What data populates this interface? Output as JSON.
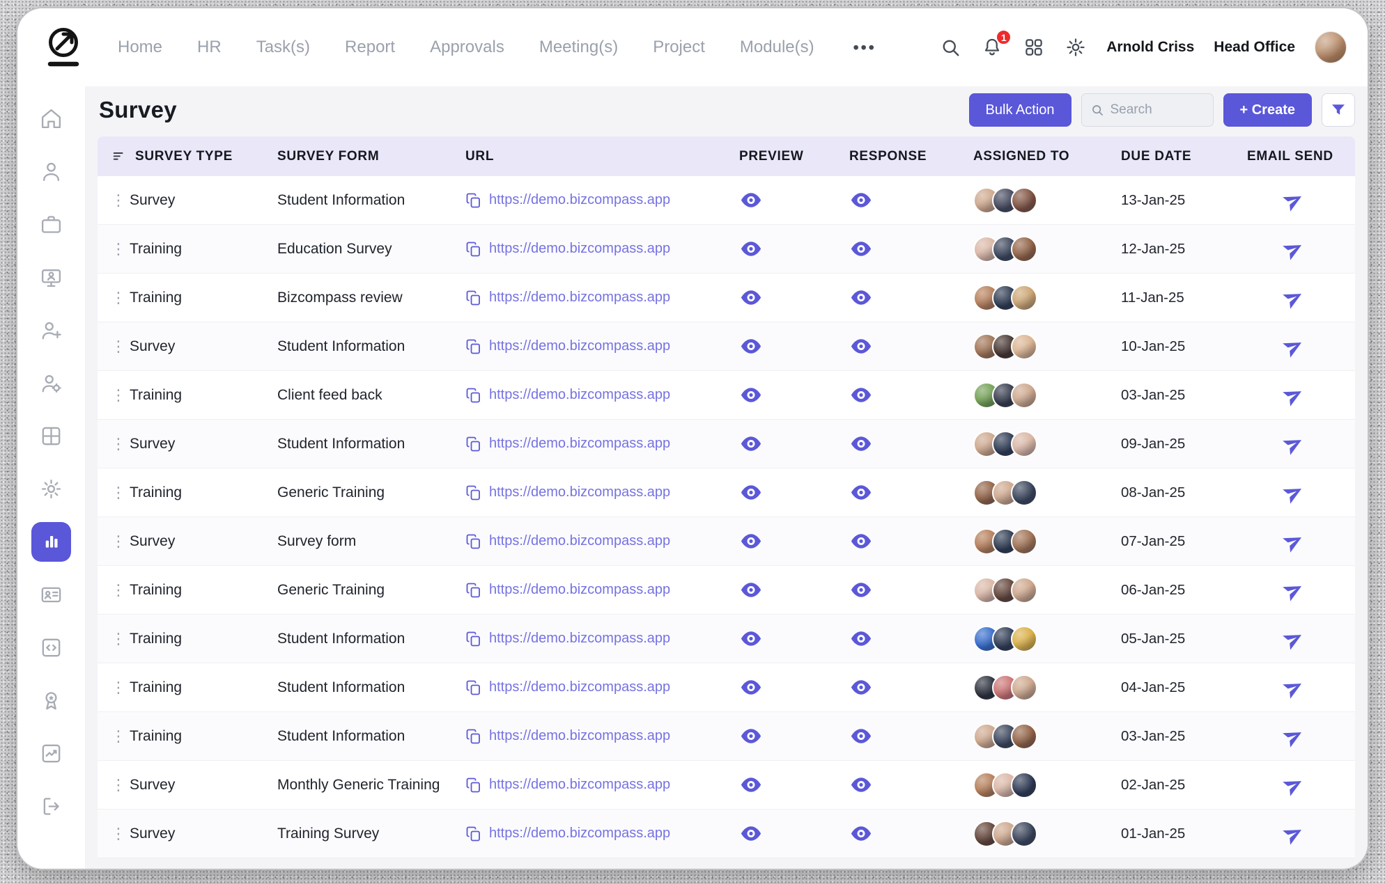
{
  "topnav": {
    "items": [
      "Home",
      "HR",
      "Task(s)",
      "Report",
      "Approvals",
      "Meeting(s)",
      "Project",
      "Module(s)"
    ],
    "notification_count": "1",
    "user_name": "Arnold Criss",
    "location": "Head Office"
  },
  "icons": {
    "more_menu": "•••",
    "drag_handle": "⋮"
  },
  "page": {
    "title": "Survey",
    "bulk_action_label": "Bulk Action",
    "search_placeholder": "Search",
    "create_label": "+ Create"
  },
  "table": {
    "headers": [
      "SURVEY TYPE",
      "SURVEY FORM",
      "URL",
      "PREVIEW",
      "RESPONSE",
      "ASSIGNED TO",
      "DUE DATE",
      "EMAIL SEND"
    ],
    "rows": [
      {
        "type": "Survey",
        "form": "Student Information",
        "url": "https://demo.bizcompass.app",
        "due": "13-Jan-25",
        "avatars": [
          "#caa286",
          "#3b3f54",
          "#7a4a38"
        ]
      },
      {
        "type": "Training",
        "form": "Education Survey",
        "url": "https://demo.bizcompass.app",
        "due": "12-Jan-25",
        "avatars": [
          "#d7b2a0",
          "#303b52",
          "#8c5a3c"
        ]
      },
      {
        "type": "Training",
        "form": "Bizcompass review",
        "url": "https://demo.bizcompass.app",
        "due": "11-Jan-25",
        "avatars": [
          "#b0764f",
          "#223048",
          "#c9a06b"
        ]
      },
      {
        "type": "Survey",
        "form": "Student Information",
        "url": "https://demo.bizcompass.app",
        "due": "10-Jan-25",
        "avatars": [
          "#9a6a4a",
          "#3c2a24",
          "#d9b08c"
        ]
      },
      {
        "type": "Training",
        "form": "Client feed back",
        "url": "https://demo.bizcompass.app",
        "due": "03-Jan-25",
        "avatars": [
          "#6a9a4a",
          "#2a3042",
          "#caa286"
        ]
      },
      {
        "type": "Survey",
        "form": "Student Information",
        "url": "https://demo.bizcompass.app",
        "due": "09-Jan-25",
        "avatars": [
          "#caa286",
          "#23304a",
          "#d7b2a0"
        ]
      },
      {
        "type": "Training",
        "form": "Generic Training",
        "url": "https://demo.bizcompass.app",
        "due": "08-Jan-25",
        "avatars": [
          "#8c5a3c",
          "#caa286",
          "#303b52"
        ]
      },
      {
        "type": "Survey",
        "form": "Survey form",
        "url": "https://demo.bizcompass.app",
        "due": "07-Jan-25",
        "avatars": [
          "#b0764f",
          "#223048",
          "#9a6a4a"
        ]
      },
      {
        "type": "Training",
        "form": "Generic Training",
        "url": "https://demo.bizcompass.app",
        "due": "06-Jan-25",
        "avatars": [
          "#d7b2a0",
          "#5a3a2e",
          "#caa286"
        ]
      },
      {
        "type": "Training",
        "form": "Student Information",
        "url": "https://demo.bizcompass.app",
        "due": "05-Jan-25",
        "avatars": [
          "#2a63c8",
          "#23304a",
          "#d8ab3e"
        ]
      },
      {
        "type": "Training",
        "form": "Student Information",
        "url": "https://demo.bizcompass.app",
        "due": "04-Jan-25",
        "avatars": [
          "#1f2430",
          "#c86a6a",
          "#caa286"
        ]
      },
      {
        "type": "Training",
        "form": "Student Information",
        "url": "https://demo.bizcompass.app",
        "due": "03-Jan-25",
        "avatars": [
          "#caa286",
          "#303b52",
          "#8c5a3c"
        ]
      },
      {
        "type": "Survey",
        "form": "Monthly Generic Training",
        "url": "https://demo.bizcompass.app",
        "due": "02-Jan-25",
        "avatars": [
          "#b0764f",
          "#d7b2a0",
          "#23304a"
        ]
      },
      {
        "type": "Survey",
        "form": "Training Survey",
        "url": "https://demo.bizcompass.app",
        "due": "01-Jan-25",
        "avatars": [
          "#5a3a2e",
          "#caa286",
          "#303b52"
        ]
      }
    ]
  },
  "colors": {
    "accent": "#5a57d9",
    "table_header_bg": "#e9e7f8",
    "link": "#7572e2",
    "notification_badge": "#ee2b2b"
  }
}
